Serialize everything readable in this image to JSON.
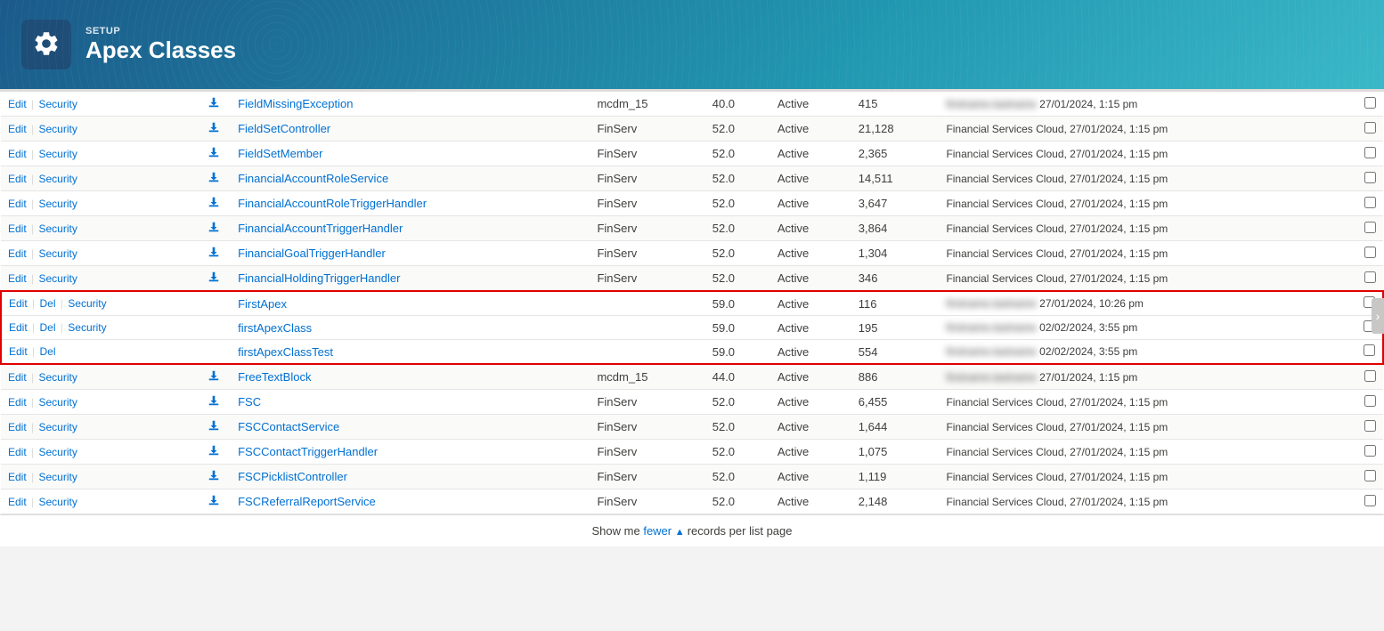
{
  "header": {
    "setup_label": "SETUP",
    "title": "Apex Classes",
    "icon_label": "gear-icon"
  },
  "footer": {
    "text_prefix": "Show me ",
    "fewer_label": "fewer",
    "text_suffix": " records per list page"
  },
  "table": {
    "rows": [
      {
        "id": 1,
        "actions": [
          "Edit",
          "Security"
        ],
        "has_del": false,
        "has_download": true,
        "name": "FieldMissingException",
        "namespace": "mcdm_15",
        "api_version": "40.0",
        "status": "Active",
        "size": "415",
        "modified_by": "BLURRED",
        "modified_date": "27/01/2024, 1:15 pm",
        "highlighted": false
      },
      {
        "id": 2,
        "actions": [
          "Edit",
          "Security"
        ],
        "has_del": false,
        "has_download": true,
        "name": "FieldSetController",
        "namespace": "FinServ",
        "api_version": "52.0",
        "status": "Active",
        "size": "21,128",
        "modified_by": "Financial Services Cloud,",
        "modified_date": "27/01/2024, 1:15 pm",
        "highlighted": false
      },
      {
        "id": 3,
        "actions": [
          "Edit",
          "Security"
        ],
        "has_del": false,
        "has_download": true,
        "name": "FieldSetMember",
        "namespace": "FinServ",
        "api_version": "52.0",
        "status": "Active",
        "size": "2,365",
        "modified_by": "Financial Services Cloud,",
        "modified_date": "27/01/2024, 1:15 pm",
        "highlighted": false
      },
      {
        "id": 4,
        "actions": [
          "Edit",
          "Security"
        ],
        "has_del": false,
        "has_download": true,
        "name": "FinancialAccountRoleService",
        "namespace": "FinServ",
        "api_version": "52.0",
        "status": "Active",
        "size": "14,511",
        "modified_by": "Financial Services Cloud,",
        "modified_date": "27/01/2024, 1:15 pm",
        "highlighted": false
      },
      {
        "id": 5,
        "actions": [
          "Edit",
          "Security"
        ],
        "has_del": false,
        "has_download": true,
        "name": "FinancialAccountRoleTriggerHandler",
        "namespace": "FinServ",
        "api_version": "52.0",
        "status": "Active",
        "size": "3,647",
        "modified_by": "Financial Services Cloud,",
        "modified_date": "27/01/2024, 1:15 pm",
        "highlighted": false
      },
      {
        "id": 6,
        "actions": [
          "Edit",
          "Security"
        ],
        "has_del": false,
        "has_download": true,
        "name": "FinancialAccountTriggerHandler",
        "namespace": "FinServ",
        "api_version": "52.0",
        "status": "Active",
        "size": "3,864",
        "modified_by": "Financial Services Cloud,",
        "modified_date": "27/01/2024, 1:15 pm",
        "highlighted": false
      },
      {
        "id": 7,
        "actions": [
          "Edit",
          "Security"
        ],
        "has_del": false,
        "has_download": true,
        "name": "FinancialGoalTriggerHandler",
        "namespace": "FinServ",
        "api_version": "52.0",
        "status": "Active",
        "size": "1,304",
        "modified_by": "Financial Services Cloud,",
        "modified_date": "27/01/2024, 1:15 pm",
        "highlighted": false
      },
      {
        "id": 8,
        "actions": [
          "Edit",
          "Security"
        ],
        "has_del": false,
        "has_download": true,
        "name": "FinancialHoldingTriggerHandler",
        "namespace": "FinServ",
        "api_version": "52.0",
        "status": "Active",
        "size": "346",
        "modified_by": "Financial Services Cloud,",
        "modified_date": "27/01/2024, 1:15 pm",
        "highlighted": false
      },
      {
        "id": 9,
        "actions": [
          "Edit",
          "Del",
          "Security"
        ],
        "has_del": true,
        "has_download": false,
        "name": "FirstApex",
        "namespace": "",
        "api_version": "59.0",
        "status": "Active",
        "size": "116",
        "modified_by": "BLURRED",
        "modified_date": "27/01/2024, 10:26 pm",
        "highlighted": true
      },
      {
        "id": 10,
        "actions": [
          "Edit",
          "Del",
          "Security"
        ],
        "has_del": true,
        "has_download": false,
        "name": "firstApexClass",
        "namespace": "",
        "api_version": "59.0",
        "status": "Active",
        "size": "195",
        "modified_by": "BLURRED",
        "modified_date": "02/02/2024, 3:55 pm",
        "highlighted": true
      },
      {
        "id": 11,
        "actions": [
          "Edit",
          "Del"
        ],
        "has_del": true,
        "has_download": false,
        "name": "firstApexClassTest",
        "namespace": "",
        "api_version": "59.0",
        "status": "Active",
        "size": "554",
        "modified_by": "BLURRED",
        "modified_date": "02/02/2024, 3:55 pm",
        "highlighted": true
      },
      {
        "id": 12,
        "actions": [
          "Edit",
          "Security"
        ],
        "has_del": false,
        "has_download": true,
        "name": "FreeTextBlock",
        "namespace": "mcdm_15",
        "api_version": "44.0",
        "status": "Active",
        "size": "886",
        "modified_by": "BLURRED",
        "modified_date": "27/01/2024, 1:15 pm",
        "highlighted": false
      },
      {
        "id": 13,
        "actions": [
          "Edit",
          "Security"
        ],
        "has_del": false,
        "has_download": true,
        "name": "FSC",
        "namespace": "FinServ",
        "api_version": "52.0",
        "status": "Active",
        "size": "6,455",
        "modified_by": "Financial Services Cloud,",
        "modified_date": "27/01/2024, 1:15 pm",
        "highlighted": false
      },
      {
        "id": 14,
        "actions": [
          "Edit",
          "Security"
        ],
        "has_del": false,
        "has_download": true,
        "name": "FSCContactService",
        "namespace": "FinServ",
        "api_version": "52.0",
        "status": "Active",
        "size": "1,644",
        "modified_by": "Financial Services Cloud,",
        "modified_date": "27/01/2024, 1:15 pm",
        "highlighted": false
      },
      {
        "id": 15,
        "actions": [
          "Edit",
          "Security"
        ],
        "has_del": false,
        "has_download": true,
        "name": "FSCContactTriggerHandler",
        "namespace": "FinServ",
        "api_version": "52.0",
        "status": "Active",
        "size": "1,075",
        "modified_by": "Financial Services Cloud,",
        "modified_date": "27/01/2024, 1:15 pm",
        "highlighted": false
      },
      {
        "id": 16,
        "actions": [
          "Edit",
          "Security"
        ],
        "has_del": false,
        "has_download": true,
        "name": "FSCPicklistController",
        "namespace": "FinServ",
        "api_version": "52.0",
        "status": "Active",
        "size": "1,119",
        "modified_by": "Financial Services Cloud,",
        "modified_date": "27/01/2024, 1:15 pm",
        "highlighted": false
      },
      {
        "id": 17,
        "actions": [
          "Edit",
          "Security"
        ],
        "has_del": false,
        "has_download": true,
        "name": "FSCReferralReportService",
        "namespace": "FinServ",
        "api_version": "52.0",
        "status": "Active",
        "size": "2,148",
        "modified_by": "Financial Services Cloud,",
        "modified_date": "27/01/2024, 1:15 pm",
        "highlighted": false
      }
    ]
  }
}
